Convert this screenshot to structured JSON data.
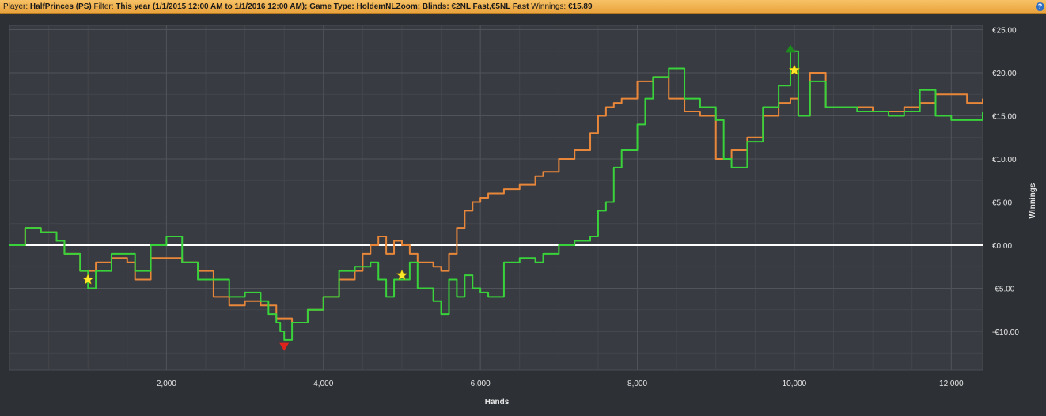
{
  "header": {
    "player_label": "Player:",
    "player_value": "HalfPrinces (PS)",
    "filter_label": "Filter:",
    "filter_value": "This year (1/1/2015 12:00 AM to 1/1/2016 12:00 AM); Game Type: HoldemNLZoom; Blinds: €2NL Fast,€5NL Fast",
    "winnings_label": "Winnings:",
    "winnings_value": "€15.89",
    "help_glyph": "?"
  },
  "chart_data": {
    "type": "line",
    "xlabel": "Hands",
    "ylabel": "Winnings",
    "xlim": [
      0,
      12400
    ],
    "ylim": [
      -14.5,
      25.5
    ],
    "x_ticks": [
      2000,
      4000,
      6000,
      8000,
      10000,
      12000
    ],
    "x_tick_labels": [
      "2,000",
      "4,000",
      "6,000",
      "8,000",
      "10,000",
      "12,000"
    ],
    "y_ticks": [
      25,
      20,
      15,
      10,
      5,
      0,
      -5,
      -10
    ],
    "y_tick_labels": [
      "€25.00",
      "€20.00",
      "€15.00",
      "€10.00",
      "€5.00",
      "€0.00",
      "-€5.00",
      "-€10.00"
    ],
    "grid": true,
    "series": [
      {
        "color": "#e8873a",
        "x": [
          0,
          200,
          400,
          600,
          700,
          900,
          1100,
          1300,
          1500,
          1600,
          1800,
          2000,
          2200,
          2400,
          2600,
          2800,
          3000,
          3200,
          3400,
          3600,
          3800,
          4000,
          4200,
          4400,
          4500,
          4600,
          4700,
          4800,
          4900,
          5000,
          5100,
          5200,
          5400,
          5500,
          5600,
          5700,
          5800,
          5900,
          6000,
          6100,
          6300,
          6500,
          6700,
          6800,
          7000,
          7200,
          7400,
          7500,
          7600,
          7700,
          7800,
          8000,
          8200,
          8400,
          8600,
          8800,
          9000,
          9200,
          9400,
          9600,
          9800,
          9950,
          10050,
          10200,
          10400,
          10600,
          10800,
          11000,
          11200,
          11400,
          11600,
          11800,
          12000,
          12200,
          12400
        ],
        "y": [
          0,
          2,
          1.5,
          0.5,
          -1,
          -3,
          -2,
          -1.5,
          -2,
          -4,
          -1.5,
          -1.5,
          -2,
          -3,
          -6,
          -7,
          -6.5,
          -7,
          -8.5,
          -9,
          -7.5,
          -6,
          -4,
          -3,
          -1,
          0,
          1,
          -1,
          0.5,
          0,
          -1,
          -2,
          -2.5,
          -3,
          -1,
          2,
          4,
          5,
          5.5,
          6,
          6.5,
          7,
          8,
          8.5,
          10,
          11,
          13,
          15,
          16,
          16.5,
          17,
          19,
          19.5,
          17,
          15.5,
          15,
          10,
          11,
          12.5,
          15,
          16.5,
          17,
          15,
          20,
          16,
          16,
          16,
          15.5,
          15.5,
          16,
          16.5,
          17.5,
          17.5,
          16.5,
          17
        ]
      },
      {
        "color": "#39d23a",
        "x": [
          0,
          200,
          400,
          600,
          700,
          900,
          1000,
          1100,
          1300,
          1500,
          1600,
          1800,
          2000,
          2200,
          2400,
          2600,
          2800,
          3000,
          3200,
          3300,
          3400,
          3450,
          3500,
          3600,
          3800,
          4000,
          4200,
          4400,
          4600,
          4700,
          4800,
          4900,
          5000,
          5100,
          5200,
          5400,
          5500,
          5600,
          5700,
          5800,
          5900,
          6000,
          6100,
          6300,
          6500,
          6700,
          6800,
          7000,
          7200,
          7400,
          7500,
          7600,
          7700,
          7800,
          8000,
          8100,
          8200,
          8400,
          8600,
          8800,
          9000,
          9100,
          9200,
          9400,
          9600,
          9800,
          9950,
          10050,
          10200,
          10400,
          10600,
          10800,
          11000,
          11200,
          11400,
          11600,
          11800,
          12000,
          12200,
          12400
        ],
        "y": [
          0,
          2,
          1.5,
          0.5,
          -1,
          -3,
          -5,
          -3,
          -1,
          -1,
          -3,
          0,
          1,
          -2,
          -4,
          -4,
          -6,
          -5.5,
          -6.5,
          -8,
          -9,
          -10,
          -11,
          -9,
          -7.5,
          -6,
          -3,
          -2.5,
          -2,
          -4,
          -6,
          -4,
          -4,
          -2,
          -5,
          -6.5,
          -8,
          -4,
          -6,
          -3.5,
          -5,
          -5.5,
          -6,
          -2,
          -1.5,
          -2,
          -1,
          0,
          0.5,
          1,
          4,
          5,
          9,
          11,
          14,
          17,
          19.5,
          20.5,
          17,
          16,
          14.5,
          10,
          9,
          12,
          16,
          18.5,
          22.5,
          15,
          19,
          16,
          16,
          15.5,
          15.5,
          15,
          15.5,
          18,
          15,
          14.5,
          14.5,
          15.5
        ]
      }
    ],
    "zero_line": 0,
    "markers": [
      {
        "type": "star",
        "x": 1000,
        "y": -4,
        "color": "#ffe82a"
      },
      {
        "type": "star",
        "x": 5000,
        "y": -3.5,
        "color": "#ffe82a"
      },
      {
        "type": "star",
        "x": 10000,
        "y": 20.3,
        "color": "#ffe82a"
      },
      {
        "type": "min-triangle",
        "x": 3500,
        "y": -11.8,
        "color": "#e0241c"
      },
      {
        "type": "max-triangle",
        "x": 9950,
        "y": 22.8,
        "color": "#1d8a1d"
      }
    ]
  }
}
